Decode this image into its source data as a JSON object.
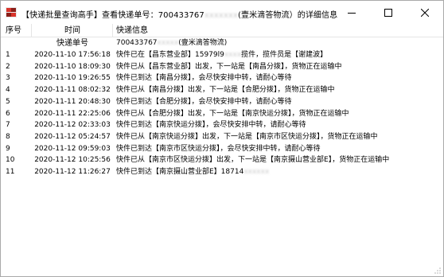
{
  "window": {
    "title_prefix": "【快递批量查询高手】查看快递单号：700433767",
    "title_masked": "xxxxxxx",
    "title_suffix": "(壹米滴答物流）的详细信息"
  },
  "table": {
    "headers": [
      "序号",
      "时间",
      "快递信息"
    ],
    "subheader": {
      "time": "快递单号",
      "info_prefix": "700433767",
      "info_masked": "xxxxx",
      "info_suffix": "(壹米滴答物流)"
    },
    "rows": [
      {
        "idx": "1",
        "time": "2020-11-10 17:56:18",
        "info_prefix": "快件已在【昌东营业部】15979l9",
        "info_masked": "xxxx",
        "info_suffix": "揽件，揽件员是【谢建波】"
      },
      {
        "idx": "2",
        "time": "2020-11-10 18:09:30",
        "info_prefix": "快件已从【昌东营业部】出发，下一站是【南昌分拨】，货物正在运输中",
        "info_masked": "",
        "info_suffix": ""
      },
      {
        "idx": "3",
        "time": "2020-11-10 19:26:55",
        "info_prefix": "快件已到达【南昌分拨】，会尽快安排中转，请耐心等待",
        "info_masked": "",
        "info_suffix": ""
      },
      {
        "idx": "4",
        "time": "2020-11-11 08:02:32",
        "info_prefix": "快件已从【南昌分拨】出发，下一站是【合肥分拨】，货物正在运输中",
        "info_masked": "",
        "info_suffix": ""
      },
      {
        "idx": "5",
        "time": "2020-11-11 20:48:30",
        "info_prefix": "快件已到达【合肥分拨】，会尽快安排中转，请耐心等待",
        "info_masked": "",
        "info_suffix": ""
      },
      {
        "idx": "6",
        "time": "2020-11-11 22:25:06",
        "info_prefix": "快件已从【合肥分拨】出发，下一站是【南京快运分拨】，货物正在运输中",
        "info_masked": "",
        "info_suffix": ""
      },
      {
        "idx": "7",
        "time": "2020-11-12 02:33:03",
        "info_prefix": "快件已到达【南京快运分拨】，会尽快安排中转，请耐心等待",
        "info_masked": "",
        "info_suffix": ""
      },
      {
        "idx": "8",
        "time": "2020-11-12 05:24:57",
        "info_prefix": "快件已从【南京快运分拨】出发，下一站是【南京市区快运分拨】，货物正在运输中",
        "info_masked": "",
        "info_suffix": ""
      },
      {
        "idx": "9",
        "time": "2020-11-12 09:59:03",
        "info_prefix": "快件已到达【南京市区快运分拨】，会尽快安排中转，请耐心等待",
        "info_masked": "",
        "info_suffix": ""
      },
      {
        "idx": "10",
        "time": "2020-11-12 10:25:56",
        "info_prefix": "快件已从【南京市区快运分拨】出发，下一站是【南京摄山营业部E】，货物正在运输中",
        "info_masked": "",
        "info_suffix": ""
      },
      {
        "idx": "11",
        "time": "2020-11-12 11:26:27",
        "info_prefix": "快件已到达【南京摄山营业部E】18714",
        "info_masked": "xxxxxx",
        "info_suffix": ""
      }
    ]
  },
  "colors": {
    "app_icon_red": "#d9342b",
    "app_icon_dark": "#8a1e18"
  }
}
